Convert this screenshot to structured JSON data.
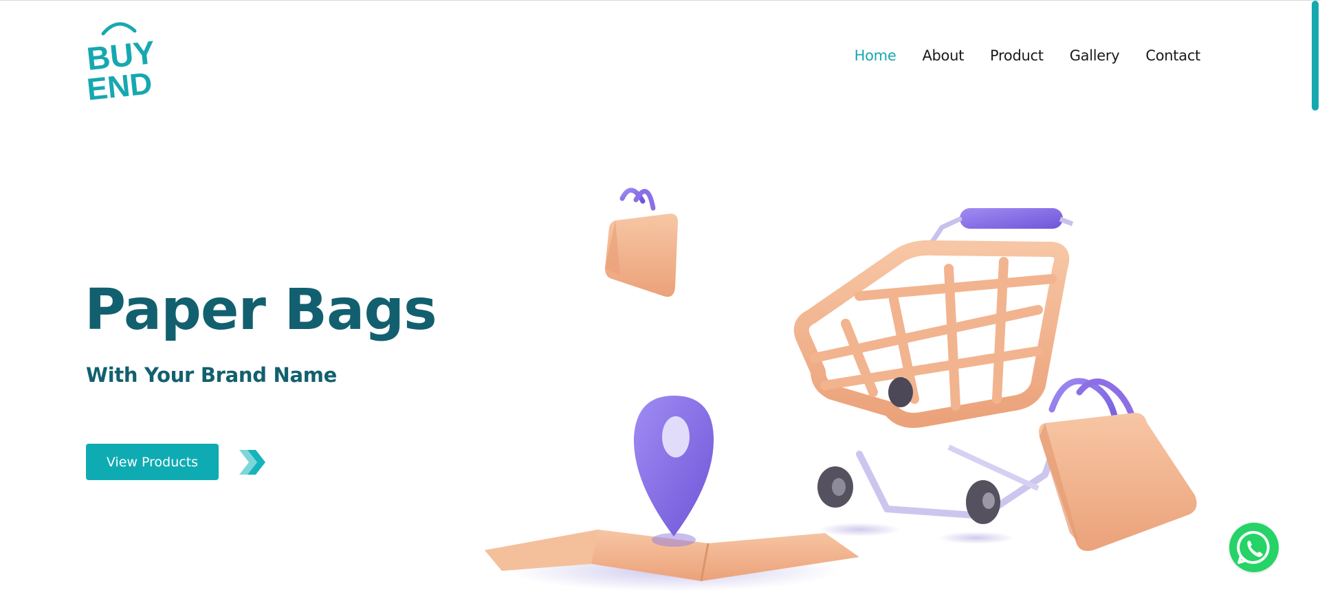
{
  "brand": {
    "logo_line1": "BUY",
    "logo_line2": "END",
    "accent": "#16a8b0",
    "dark": "#12606f"
  },
  "nav": {
    "items": [
      "Home",
      "About",
      "Product",
      "Gallery",
      "Contact"
    ],
    "active": "Home"
  },
  "hero": {
    "title": "Paper Bags",
    "subtitle": "With Your Brand Name",
    "cta_label": "View Products"
  },
  "icons": {
    "cta_arrow": "double-chevron-right-icon",
    "whatsapp": "whatsapp-icon"
  },
  "colors": {
    "illustration_peach": "#f1b48f",
    "illustration_purple": "#8c6fe6",
    "whatsapp_green": "#25d366"
  }
}
